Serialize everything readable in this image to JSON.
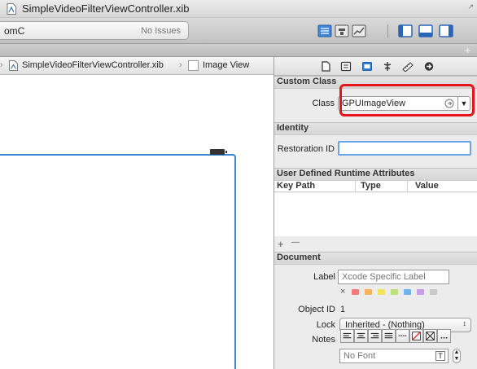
{
  "window": {
    "title": "SimpleVideoFilterViewController.xib"
  },
  "toolbar": {
    "scheme": "omC",
    "status": "No Issues"
  },
  "jumpbar": {
    "file": "SimpleVideoFilterViewController.xib",
    "item": "Image View"
  },
  "inspector": {
    "custom_class": {
      "heading": "Custom Class",
      "class_label": "Class",
      "class_value": "GPUImageView"
    },
    "identity": {
      "heading": "Identity",
      "restoration_label": "Restoration ID",
      "restoration_value": ""
    },
    "runtime_attributes": {
      "heading": "User Defined Runtime Attributes",
      "columns": [
        "Key Path",
        "Type",
        "Value"
      ],
      "add": "+",
      "remove": "—"
    },
    "document": {
      "heading": "Document",
      "label_label": "Label",
      "label_placeholder": "Xcode Specific Label",
      "clear_mark": "×",
      "object_id_label": "Object ID",
      "object_id_value": "1",
      "lock_label": "Lock",
      "lock_value": "Inherited - (Nothing)",
      "notes_label": "Notes",
      "font_placeholder": "No Font"
    }
  },
  "colors": {
    "accent": "#3a83d6",
    "highlight": "#e8131b",
    "swatches": [
      "#f47b7b",
      "#f7b45a",
      "#f2e35c",
      "#bce07a",
      "#6fb6f0",
      "#c89ce8",
      "#c8c8c8"
    ]
  }
}
